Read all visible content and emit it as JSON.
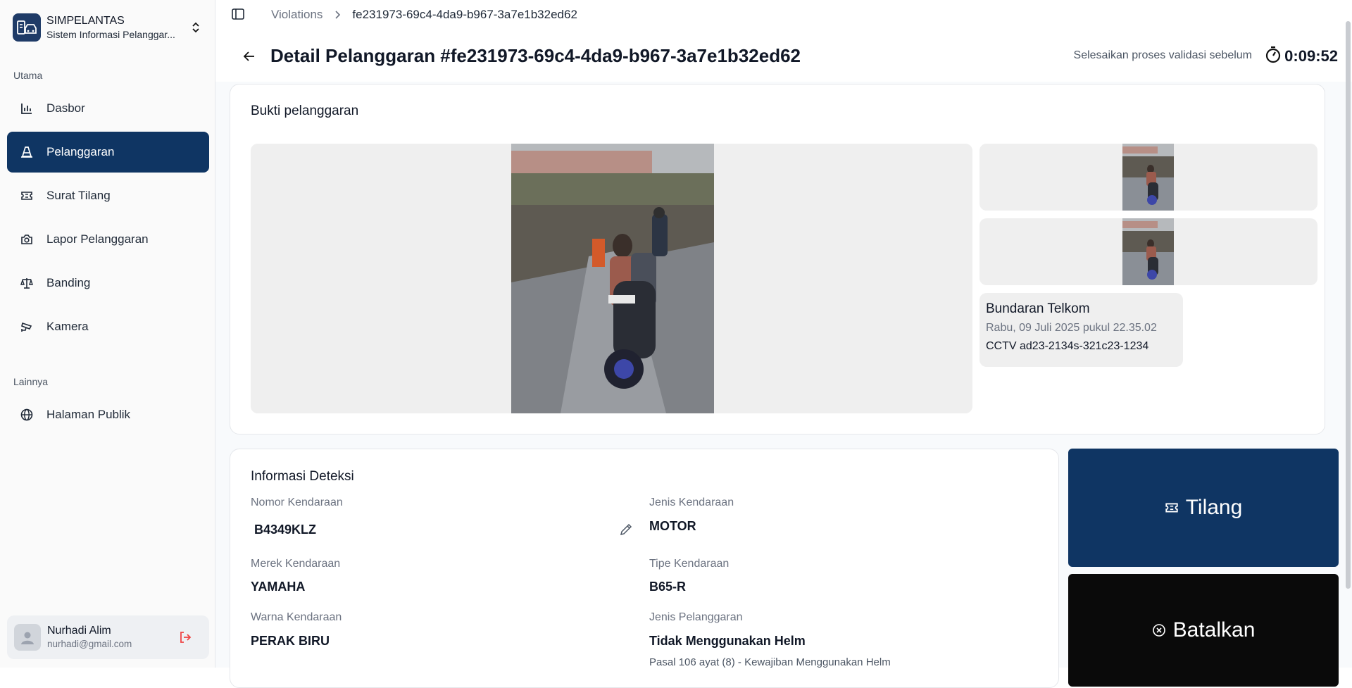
{
  "sidebar": {
    "brand_name": "SIMPELANTAS",
    "brand_sub": "Sistem Informasi Pelanggar...",
    "group_main": "Utama",
    "group_other": "Lainnya",
    "items": [
      {
        "label": "Dasbor",
        "icon": "chart-bar-icon"
      },
      {
        "label": "Pelanggaran",
        "icon": "traffic-cone-icon",
        "active": true
      },
      {
        "label": "Surat Tilang",
        "icon": "ticket-icon"
      },
      {
        "label": "Lapor Pelanggaran",
        "icon": "camera-icon"
      },
      {
        "label": "Banding",
        "icon": "scale-icon"
      },
      {
        "label": "Kamera",
        "icon": "cctv-icon"
      },
      {
        "label": "Halaman Publik",
        "icon": "globe-icon"
      }
    ],
    "user": {
      "name": "Nurhadi Alim",
      "email": "nurhadi@gmail.com"
    }
  },
  "breadcrumb": {
    "parent": "Violations",
    "current": "fe231973-69c4-4da9-b967-3a7e1b32ed62"
  },
  "header": {
    "title": "Detail Pelanggaran #fe231973-69c4-4da9-b967-3a7e1b32ed62",
    "validate_text": "Selesaikan proses validasi sebelum",
    "timer": "0:09:52"
  },
  "evidence": {
    "title": "Bukti pelanggaran",
    "location": "Bundaran Telkom",
    "datetime": "Rabu, 09 Juli 2025 pukul 22.35.02",
    "camera": "CCTV ad23-2134s-321c23-1234"
  },
  "detection": {
    "title": "Informasi Deteksi",
    "plate_label": "Nomor Kendaraan",
    "plate_value": "B4349KLZ",
    "vehicle_type_label": "Jenis Kendaraan",
    "vehicle_type_value": "MOTOR",
    "brand_label": "Merek Kendaraan",
    "brand_value": "YAMAHA",
    "model_label": "Tipe Kendaraan",
    "model_value": "B65-R",
    "color_label": "Warna Kendaraan",
    "color_value": "PERAK BIRU",
    "violation_label": "Jenis Pelanggaran",
    "violation_value": "Tidak Menggunakan Helm",
    "violation_law": "Pasal 106 ayat (8) - Kewajiban Menggunakan Helm"
  },
  "actions": {
    "ticket_label": "Tilang",
    "cancel_label": "Batalkan"
  },
  "colors": {
    "primary": "#0f3563",
    "cancel": "#0a0a0a",
    "logout": "#ef4444"
  }
}
